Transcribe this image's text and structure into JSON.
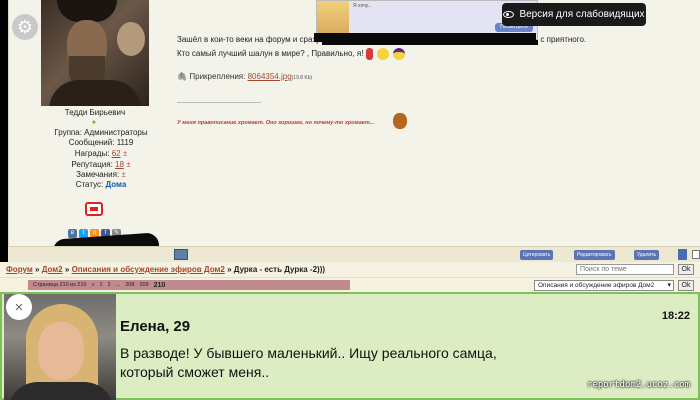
{
  "accessibility_button": {
    "label": "Версия для слабовидящих"
  },
  "user": {
    "name": "Тедди Бирьевич",
    "group": "Группа: Администраторы",
    "messages": "Сообщений: 1119",
    "awards_label": "Награды:",
    "awards_value": "62",
    "reputation_label": "Репутация:",
    "reputation_value": "18",
    "warnings_label": "Замечания:",
    "plus": "±",
    "status_label": "Статус:",
    "status_value": "Дома"
  },
  "post": {
    "line1_start": "Зашёл в кои-то веки на форум и сразу",
    "line1_end": "с приятного.",
    "line2": "Кто самый лучший шалун в мире? , Правильно, я!",
    "attachment_label": "Прикрепления:",
    "attachment_file": "8064354.jpg",
    "attachment_size": "(19.8 Kb)",
    "signature": "У меня правописание хромает. Оно хорошее, но почему-то хромает..."
  },
  "ad_thumb": {
    "text": "Я хочу...",
    "button": "Посмотреть",
    "site": "reportdom2.ucoz.com"
  },
  "actions": {
    "quote": "Цитировать",
    "edit": "Редактировать",
    "delete": "Удалить"
  },
  "breadcrumb": {
    "forum": "Форум",
    "sep": "»",
    "dom2": "Дом2",
    "section": "Описания и обсуждение эфиров Дом2",
    "topic": "Дурка - есть Дурка -2)))"
  },
  "search": {
    "placeholder": "Поиск по теме",
    "ok": "Ok"
  },
  "pager": {
    "info": "Страница 210 из 210",
    "pages": [
      "«",
      "1",
      "2",
      "..."
    ],
    "next": "208",
    "prev": "209",
    "current": "210"
  },
  "forum_select": {
    "value": "Описания и обсуждение эфиров Дом2",
    "ok": "Ok"
  },
  "popup": {
    "close": "×",
    "name": "Елена, 29",
    "time": "18:22",
    "message": "В разводе! У бывшего маленький.. Ищу реального самца, который сможет меня..",
    "watermark": "reportdom2.ucoz.com"
  }
}
